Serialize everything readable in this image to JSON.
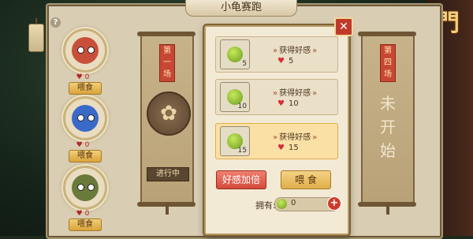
{
  "title": "小龟赛跑",
  "logo_text": "蜀門",
  "help_label": "?",
  "turtles": [
    {
      "name": "red-turtle",
      "hearts": "0",
      "feed_label": "喂食",
      "color": "#c8503a"
    },
    {
      "name": "blue-turtle",
      "hearts": "0",
      "feed_label": "喂食",
      "color": "#3a6ac8"
    },
    {
      "name": "green-turtle",
      "hearts": "0",
      "feed_label": "喂食",
      "color": "#6a7a3a"
    }
  ],
  "race1": {
    "tag": "第一场",
    "status": "进行中",
    "emblem": "✿"
  },
  "race4": {
    "tag": "第四场",
    "big_text": "未开始"
  },
  "popup": {
    "items": [
      {
        "count": "5",
        "gain_label": "获得好感",
        "heart_value": "5"
      },
      {
        "count": "10",
        "gain_label": "获得好感",
        "heart_value": "10"
      },
      {
        "count": "15",
        "gain_label": "获得好感",
        "heart_value": "15"
      }
    ],
    "double_button": "好感加倍",
    "feed_button": "喂  食",
    "own_label": "拥有:",
    "own_value": "0",
    "plus_label": "+",
    "close_label": "✕"
  },
  "colors": {
    "accent_red": "#c03a2a",
    "gold": "#dfae4a",
    "selected_bg": "#fbe0a6"
  }
}
